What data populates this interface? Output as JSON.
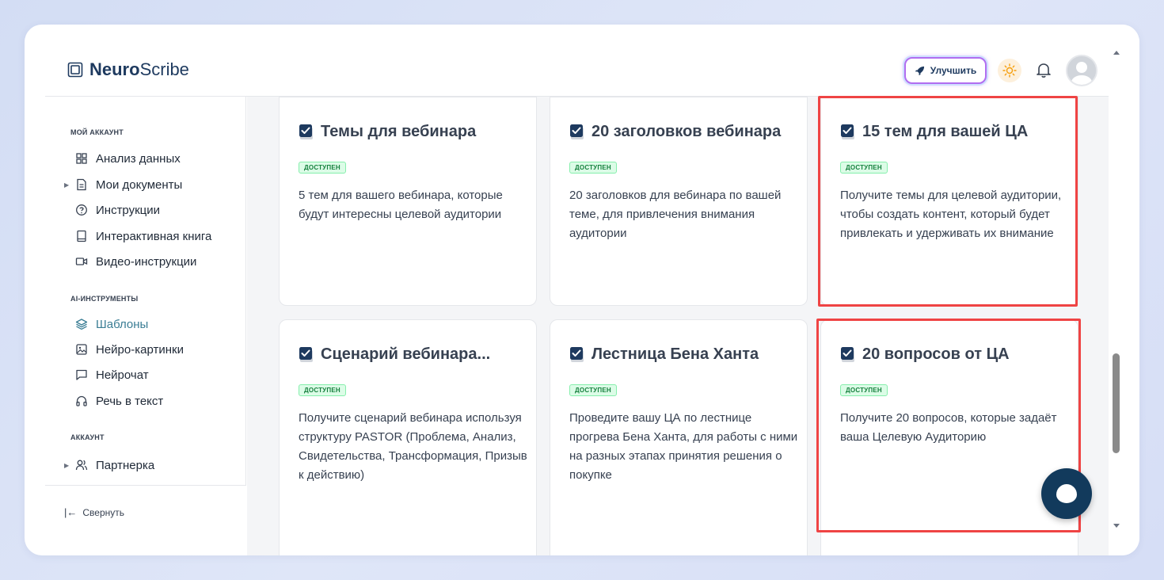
{
  "header": {
    "logo_bold": "Neuro",
    "logo_light": "Scribe",
    "upgrade_label": "Улучшить"
  },
  "sidebar": {
    "section_account": "МОЙ АККАУНТ",
    "items_account": [
      {
        "label": "Анализ данных",
        "icon": "grid-icon"
      },
      {
        "label": "Мои документы",
        "icon": "document-icon"
      },
      {
        "label": "Инструкции",
        "icon": "help-circle-icon"
      },
      {
        "label": "Интерактивная книга",
        "icon": "book-icon"
      },
      {
        "label": "Видео-инструкции",
        "icon": "video-icon"
      }
    ],
    "section_ai": "AI-ИНСТРУМЕНТЫ",
    "items_ai": [
      {
        "label": "Шаблоны",
        "icon": "layers-icon"
      },
      {
        "label": "Нейро-картинки",
        "icon": "image-icon"
      },
      {
        "label": "Нейрочат",
        "icon": "chat-icon"
      },
      {
        "label": "Речь в текст",
        "icon": "headphones-icon"
      }
    ],
    "section_acc2": "АККАУНТ",
    "items_acc2": [
      {
        "label": "Партнерка",
        "icon": "users-icon"
      }
    ],
    "collapse_label": "Свернуть"
  },
  "cards": [
    {
      "title": "Темы для вебинара",
      "badge": "ДОСТУПЕН",
      "desc": "5 тем для вашего вебинара, которые будут интересны целевой аудитории"
    },
    {
      "title": "20 заголовков вебинара",
      "badge": "ДОСТУПЕН",
      "desc": "20 заголовков для вебинара по вашей теме, для привлечения внимания аудитории"
    },
    {
      "title": "15 тем для вашей ЦА",
      "badge": "ДОСТУПЕН",
      "desc": "Получите темы для целевой аудитории, чтобы создать контент, который будет привлекать и удерживать их внимание"
    },
    {
      "title": "Сценарий вебинара...",
      "badge": "ДОСТУПЕН",
      "desc": "Получите сценарий вебинара используя структуру PASTOR (Проблема, Анализ, Свидетельства, Трансформация, Призыв к действию)"
    },
    {
      "title": "Лестница Бена Ханта",
      "badge": "ДОСТУПЕН",
      "desc": "Проведите вашу ЦА по лестнице прогрева Бена Ханта, для работы с ними на разных этапах принятия решения о покупке"
    },
    {
      "title": "20 вопросов от ЦА",
      "badge": "ДОСТУПЕН",
      "desc": "Получите 20 вопросов, которые задаёт ваша Целевую Аудиторию"
    }
  ],
  "colors": {
    "accent": "#3a7d94",
    "highlight": "#ef4444",
    "badge_green": "#15803d",
    "brand_dark": "#123a5c"
  }
}
